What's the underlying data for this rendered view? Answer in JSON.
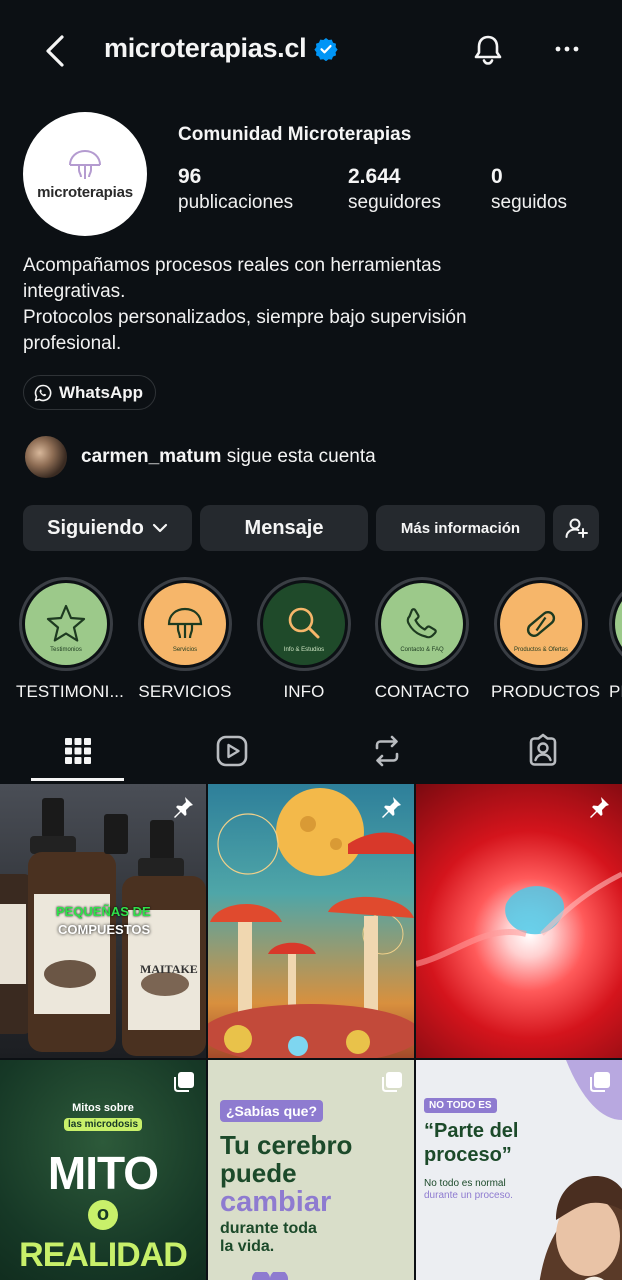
{
  "header": {
    "username": "microterapias.cl",
    "verified": true
  },
  "profile": {
    "avatar_text": "microterapias",
    "full_name": "Comunidad Microterapias",
    "stats": [
      {
        "value": "96",
        "label": "publicaciones"
      },
      {
        "value": "2.644",
        "label": "seguidores"
      },
      {
        "value": "0",
        "label": "seguidos"
      }
    ],
    "bio_lines": [
      "Acompañamos procesos reales con herramientas",
      "integrativas.",
      "Protocolos personalizados, siempre bajo supervisión",
      "profesional."
    ],
    "link_label": "WhatsApp",
    "followed_by_user": "carmen_matum",
    "followed_by_text": "sigue esta cuenta"
  },
  "actions": {
    "following_label": "Siguiendo",
    "message_label": "Mensaje",
    "more_info_label": "Más información"
  },
  "highlights": [
    {
      "label": "TESTIMONI...",
      "caption": "Testimonios",
      "color": "#9cc98a",
      "icon": "star-icon"
    },
    {
      "label": "SERVICIOS",
      "caption": "Servicios",
      "color": "#f6b66a",
      "icon": "mushroom-icon"
    },
    {
      "label": "INFO",
      "caption": "Info & Estudios",
      "color": "#1f4a2a",
      "icon": "magnifier-icon"
    },
    {
      "label": "CONTACTO",
      "caption": "Contacto & FAQ",
      "color": "#9cc98a",
      "icon": "phone-icon"
    },
    {
      "label": "PRODUCTOS",
      "caption": "Productos & Ofertas",
      "color": "#f6b66a",
      "icon": "capsule-icon"
    },
    {
      "label": "PR",
      "caption": "",
      "color": "#9cc98a",
      "icon": "highlight-icon"
    }
  ],
  "tabs": [
    "grid-icon",
    "reels-icon",
    "reposts-icon",
    "tagged-icon"
  ],
  "posts": [
    {
      "type": "pinned",
      "overlay_line1": "PEQUEÑAS DE",
      "overlay_line2": "COMPUESTOS",
      "bottle_label": "MAITAKE"
    },
    {
      "type": "pinned"
    },
    {
      "type": "pinned"
    },
    {
      "type": "carousel",
      "kicker": "Mitos sobre",
      "kicker2": "las microdosis",
      "title1": "MITO",
      "title2": "o",
      "title3": "REALIDAD"
    },
    {
      "type": "carousel",
      "tag": "¿Sabías que?",
      "line1": "Tu cerebro",
      "line2": "puede",
      "line3": "cambiar",
      "line4": "durante toda",
      "line5": "la vida."
    },
    {
      "type": "carousel",
      "tag": "NO TODO ES",
      "line1": "“Parte del",
      "line2": "proceso”",
      "small1": "No todo es normal",
      "small2": "durante un proceso."
    }
  ],
  "colors": {
    "background": "#0c1014",
    "button": "#25292e",
    "verified": "#0095f6"
  }
}
